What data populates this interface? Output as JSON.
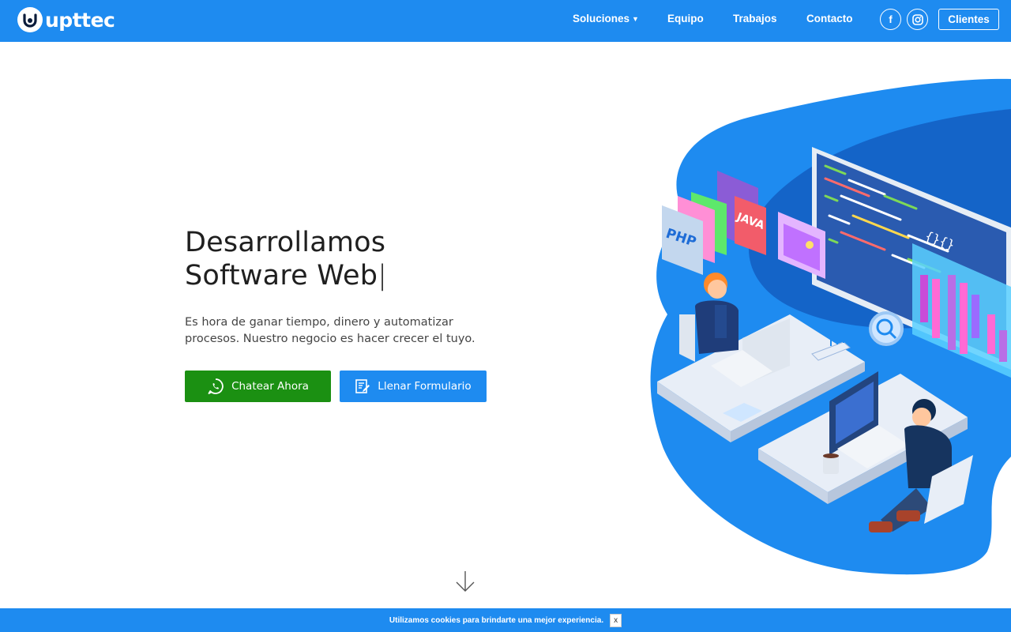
{
  "brand": {
    "name": "upttec",
    "logo_icon": "u-logo-icon",
    "accent": "#1e8bf0"
  },
  "nav": {
    "items": [
      {
        "label": "Soluciones",
        "has_dropdown": true
      },
      {
        "label": "Equipo"
      },
      {
        "label": "Trabajos"
      },
      {
        "label": "Contacto"
      }
    ],
    "social": [
      {
        "icon": "facebook-icon",
        "label": "f"
      },
      {
        "icon": "instagram-icon"
      }
    ],
    "clientes_label": "Clientes"
  },
  "hero": {
    "title_line1": "Desarrollamos",
    "title_line2": "Software Web",
    "title_cursor": "|",
    "subtitle_line1": "Es hora de ganar tiempo, dinero y automatizar",
    "subtitle_line2": "procesos. Nuestro negocio es hacer crecer el tuyo.",
    "btn_chat": {
      "label": "Chatear Ahora",
      "icon": "whatsapp-icon",
      "color": "#1b9012"
    },
    "btn_form": {
      "label": "Llenar Formulario",
      "icon": "form-icon",
      "color": "#1e8bf0"
    },
    "scroll_icon": "arrow-down-icon"
  },
  "illustration": {
    "labels": {
      "php": "PHP",
      "java": "JAVA",
      "code": "{}{}"
    }
  },
  "cookie": {
    "text": "Utilizamos cookies para brindarte una mejor experiencia.",
    "close_label": "x"
  }
}
